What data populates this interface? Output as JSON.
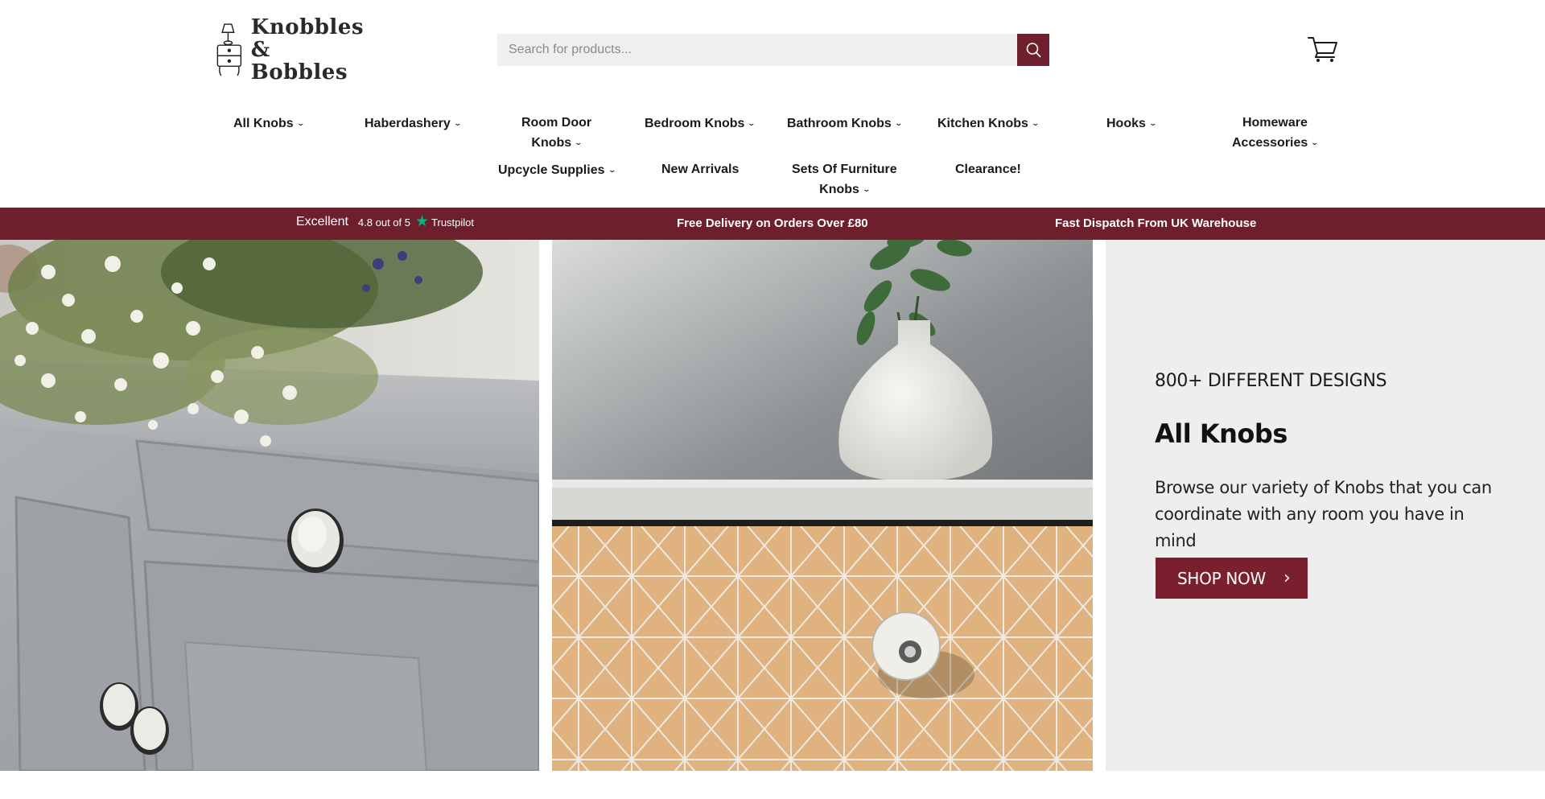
{
  "brand": {
    "logo_line1": "Knobbles",
    "logo_line2": "& Bobbles",
    "logo_icon": "bedside-table-lamp-icon"
  },
  "search": {
    "placeholder": "Search for products...",
    "button_icon": "search-icon"
  },
  "cart": {
    "icon": "cart-icon"
  },
  "nav": {
    "items": [
      {
        "label": "All Knobs",
        "has_dropdown": true
      },
      {
        "label": "Haberdashery",
        "has_dropdown": true
      },
      {
        "label_line1": "Room Door",
        "label_line2": "Knobs",
        "has_dropdown": true
      },
      {
        "label": "Bedroom Knobs",
        "has_dropdown": true
      },
      {
        "label": "Bathroom Knobs",
        "has_dropdown": true
      },
      {
        "label": "Kitchen Knobs",
        "has_dropdown": true
      },
      {
        "label": "Hooks",
        "has_dropdown": true
      },
      {
        "label_line1": "Homeware",
        "label_line2": "Accessories",
        "has_dropdown": true
      },
      {
        "label": "Upcycle Supplies",
        "has_dropdown": true
      },
      {
        "label": "New Arrivals",
        "has_dropdown": false
      },
      {
        "label_line1": "Sets Of Furniture",
        "label_line2": "Knobs",
        "has_dropdown": true
      },
      {
        "label": "Clearance!",
        "has_dropdown": false
      }
    ],
    "dropdown_glyph": "⌄"
  },
  "promo_bar": {
    "trustpilot_excellent": "Excellent",
    "trustpilot_score": "4.8 out of 5",
    "trustpilot_star": "★",
    "trustpilot_brand": "Trustpilot",
    "message_delivery": "Free Delivery on Orders Over £80",
    "message_dispatch": "Fast Dispatch From UK Warehouse"
  },
  "hero": {
    "kicker": "800+ DIFFERENT DESIGNS",
    "title": "All Knobs",
    "description": "Browse our variety of Knobs that you can coordinate with any room you have in mind",
    "cta_label": "SHOP NOW",
    "cta_arrow": "›"
  },
  "colors": {
    "accent": "#6e1f2c",
    "cta": "#7a1f2e",
    "search_bg": "#efefef",
    "hero_panel_bg": "#eeeeee",
    "trustpilot_green": "#00b67a"
  }
}
